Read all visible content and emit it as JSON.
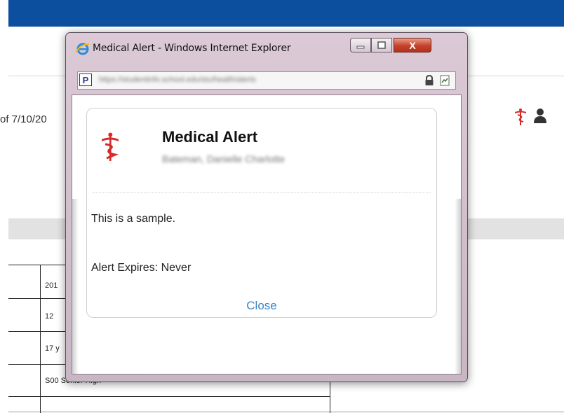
{
  "colors": {
    "top_bar": "#0d4f9f",
    "medical_icon": "#d42a2a",
    "close_link": "#3a86c8"
  },
  "background_page": {
    "as_of_text": "of 7/10/20",
    "table": {
      "rows": [
        "201",
        "12",
        "17 y",
        "S00 Senior High"
      ]
    }
  },
  "ie_window": {
    "title": "Medical Alert - Windows Internet Explorer",
    "close_glyph": "X",
    "address_bar": {
      "favicon_letter": "P",
      "url": "https://studentinfo.school.edu/stu/health/alerts"
    }
  },
  "dialog": {
    "title": "Medical Alert",
    "student_name": "Bateman, Danielle Charlotte",
    "message": "This is a sample.",
    "expires": "Alert Expires: Never",
    "close_label": "Close"
  }
}
